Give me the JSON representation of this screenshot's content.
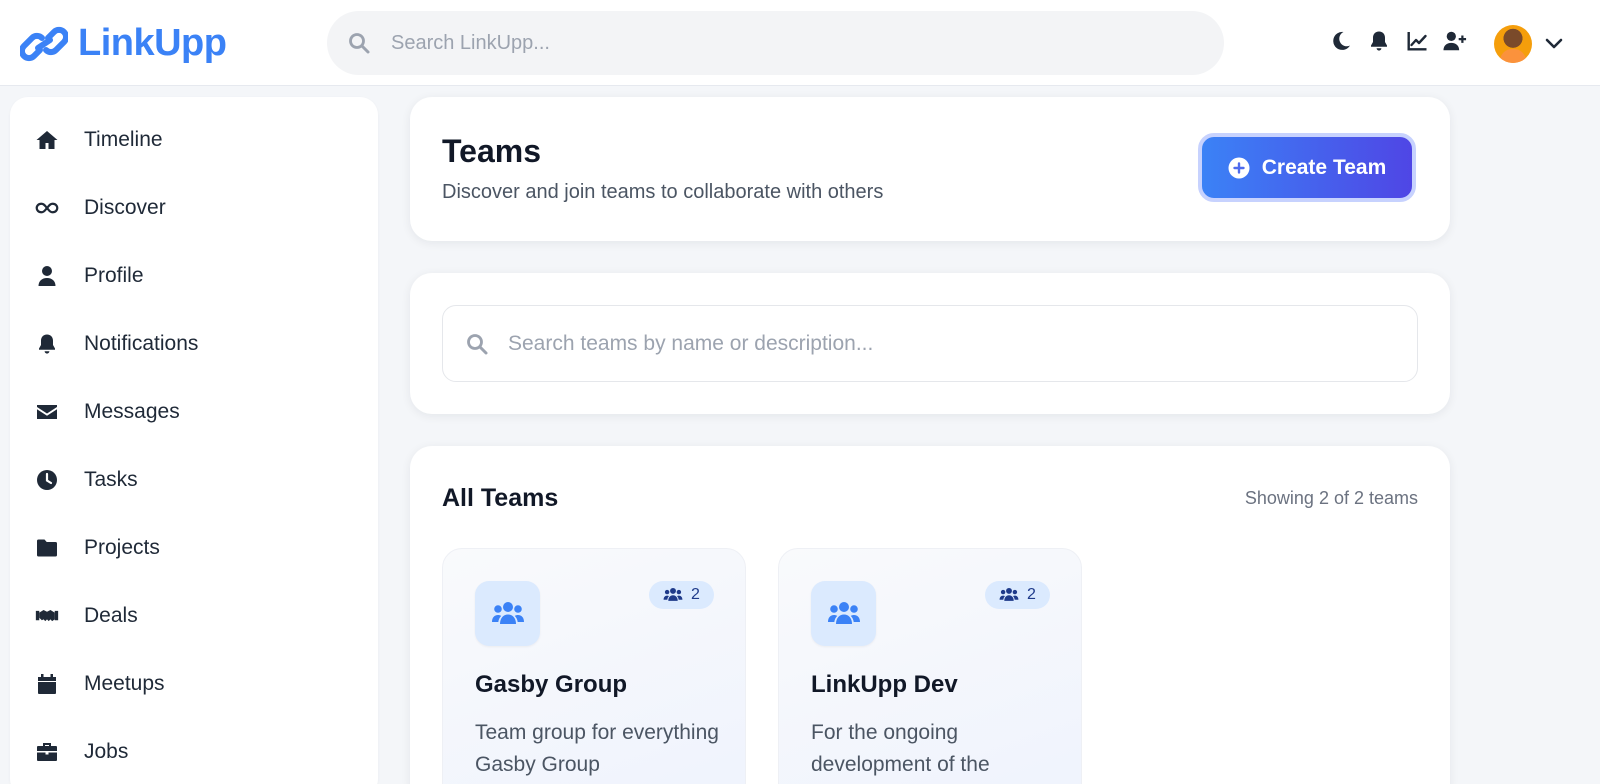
{
  "app": {
    "name": "LinkUpp",
    "search_placeholder": "Search LinkUpp..."
  },
  "header_icons": [
    "moon-icon",
    "bell-icon",
    "chart-line-icon",
    "user-plus-icon",
    "chevron-down-icon"
  ],
  "sidebar": {
    "items": [
      {
        "label": "Timeline",
        "icon": "home-icon"
      },
      {
        "label": "Discover",
        "icon": "infinity-icon"
      },
      {
        "label": "Profile",
        "icon": "user-icon"
      },
      {
        "label": "Notifications",
        "icon": "bell-icon"
      },
      {
        "label": "Messages",
        "icon": "envelope-icon"
      },
      {
        "label": "Tasks",
        "icon": "clock-icon"
      },
      {
        "label": "Projects",
        "icon": "folder-icon"
      },
      {
        "label": "Deals",
        "icon": "handshake-icon"
      },
      {
        "label": "Meetups",
        "icon": "calendar-icon"
      },
      {
        "label": "Jobs",
        "icon": "briefcase-icon"
      }
    ]
  },
  "page": {
    "title": "Teams",
    "subtitle": "Discover and join teams to collaborate with others",
    "create_button": "Create Team"
  },
  "team_search": {
    "placeholder": "Search teams by name or description..."
  },
  "teams_section": {
    "title": "All Teams",
    "showing": "Showing 2 of 2 teams",
    "teams": [
      {
        "name": "Gasby Group",
        "members": "2",
        "description": "Team group for everything Gasby Group"
      },
      {
        "name": "LinkUpp Dev",
        "members": "2",
        "description": "For the ongoing development of the"
      }
    ]
  },
  "colors": {
    "brand": "#3b82f6",
    "button_gradient_end": "#4f46e5",
    "badge_bg": "#dbeafe"
  }
}
